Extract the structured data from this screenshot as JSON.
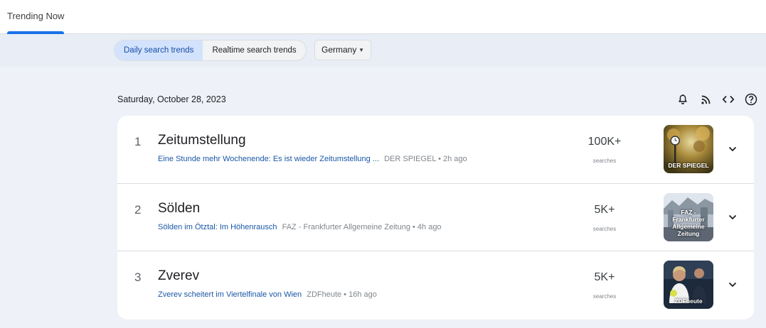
{
  "nav": {
    "tab_label": "Trending Now"
  },
  "filters": {
    "segments": [
      "Daily search trends",
      "Realtime search trends"
    ],
    "country": "Germany"
  },
  "date": "Saturday, October 28, 2023",
  "toolbar_icons": [
    "bell-icon",
    "rss-icon",
    "code-icon",
    "help-icon"
  ],
  "accent_color": "#1a73e8",
  "trends": [
    {
      "rank": "1",
      "title": "Zeitumstellung",
      "article": "Eine Stunde mehr Wochenende: Es ist wieder Zeitumstellung ...",
      "source": "DER SPIEGEL • 2h ago",
      "count": "100K+",
      "count_label": "searches",
      "thumb_label": "DER SPIEGEL"
    },
    {
      "rank": "2",
      "title": "Sölden",
      "article": "Sölden im Ötztal: Im Höhenrausch",
      "source": "FAZ - Frankfurter Allgemeine Zeitung • 4h ago",
      "count": "5K+",
      "count_label": "searches",
      "thumb_label": "FAZ - Frankfurter Allgemeine Zeitung"
    },
    {
      "rank": "3",
      "title": "Zverev",
      "article": "Zverev scheitert im Viertelfinale von Wien",
      "source": "ZDFheute • 16h ago",
      "count": "5K+",
      "count_label": "searches",
      "thumb_label": "ZDFheute"
    }
  ]
}
